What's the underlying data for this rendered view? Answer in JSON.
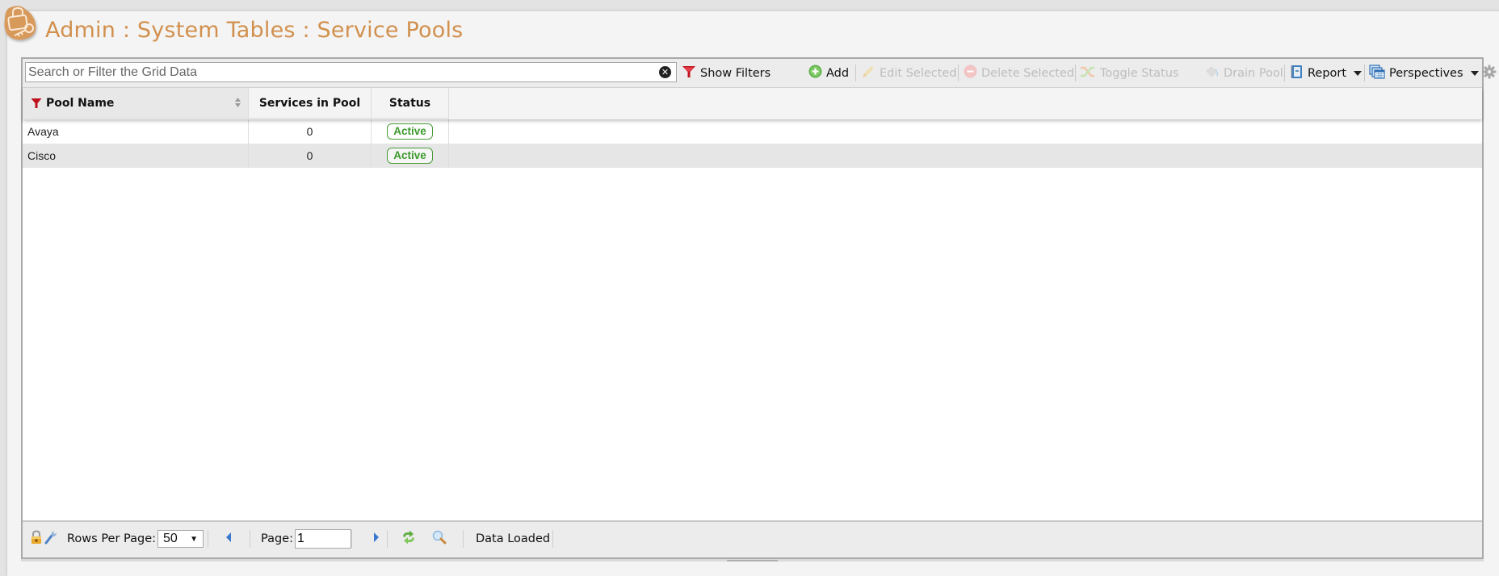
{
  "page": {
    "title": "Admin : System Tables : Service Pools",
    "logo_icon": "admin-lock-key-icon"
  },
  "toolbar": {
    "search_placeholder": "Search or Filter the Grid Data",
    "search_value": "",
    "clear_icon": "clear-circle-x-icon",
    "show_filters": {
      "label": "Show Filters",
      "icon": "funnel-icon"
    },
    "add": {
      "label": "Add",
      "icon": "plus-circle-icon",
      "enabled": true
    },
    "edit_selected": {
      "label": "Edit Selected",
      "icon": "pencil-icon",
      "enabled": false
    },
    "delete_selected": {
      "label": "Delete Selected",
      "icon": "minus-circle-icon",
      "enabled": false
    },
    "toggle_status": {
      "label": "Toggle Status",
      "icon": "shuffle-icon",
      "enabled": false
    },
    "drain_pool": {
      "label": "Drain Pool",
      "icon": "paint-bucket-icon",
      "enabled": false
    },
    "report": {
      "label": "Report",
      "icon": "notebook-icon"
    },
    "perspectives": {
      "label": "Perspectives",
      "icon": "windows-stack-icon"
    },
    "settings_icon": "gear-icon"
  },
  "grid": {
    "columns": [
      {
        "label": "Pool Name",
        "filtered": true,
        "sortable": true
      },
      {
        "label": "Services in Pool"
      },
      {
        "label": "Status"
      }
    ],
    "rows": [
      {
        "pool_name": "Avaya",
        "services": "0",
        "status": "Active"
      },
      {
        "pool_name": "Cisco",
        "services": "0",
        "status": "Active"
      }
    ]
  },
  "footer": {
    "rows_per_page_label": "Rows Per Page:",
    "rows_per_page_value": "50",
    "page_label": "Page:",
    "page_value": "1",
    "status_text": "Data Loaded",
    "icons": [
      "lock-icon",
      "wrench-icon",
      "prev-page-icon",
      "next-page-icon",
      "refresh-icon",
      "magnifier-icon"
    ]
  },
  "colors": {
    "title": "#d2904e",
    "status_active": "#3c9a2c",
    "filter_red": "#c0121c"
  }
}
